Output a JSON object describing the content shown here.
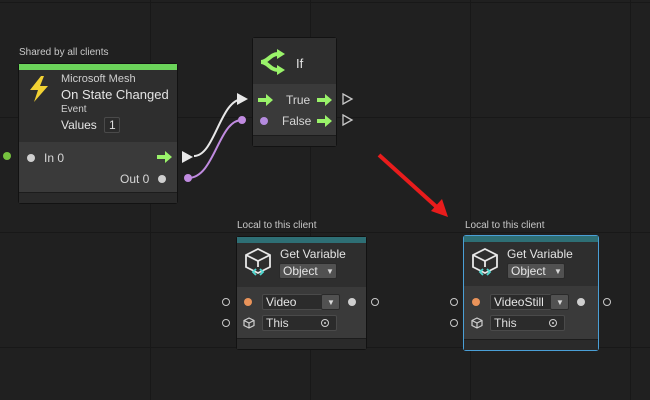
{
  "colors": {
    "event_band": "#6bd35a",
    "variable_band": "#2e6f75",
    "flow_arrow": "#9af36a",
    "data_port_purple": "#b58bdf",
    "data_port_orange": "#e9935a",
    "wire_white": "#e8e8e8",
    "wire_purple": "#c08be0",
    "annotation_red": "#e81c1c",
    "selection_outline": "#4a9fd6"
  },
  "event_node": {
    "scope": "Shared by all clients",
    "category": "Microsoft Mesh",
    "title": "On State Changed",
    "subtitle": "Event",
    "values_label": "Values",
    "values_count": "1",
    "icon": "lightning-icon",
    "in_label": "In 0",
    "out_label": "Out 0"
  },
  "if_node": {
    "title": "If",
    "icon": "branch-icon",
    "true_label": "True",
    "false_label": "False"
  },
  "get_var_left": {
    "scope": "Local to this client",
    "title": "Get Variable",
    "kind": "Object",
    "icon": "cube-variable-icon",
    "name_value": "Video",
    "object_value": "This"
  },
  "get_var_right": {
    "scope": "Local to this client",
    "title": "Get Variable",
    "kind": "Object",
    "icon": "cube-variable-icon",
    "name_value": "VideoStill",
    "object_value": "This"
  }
}
